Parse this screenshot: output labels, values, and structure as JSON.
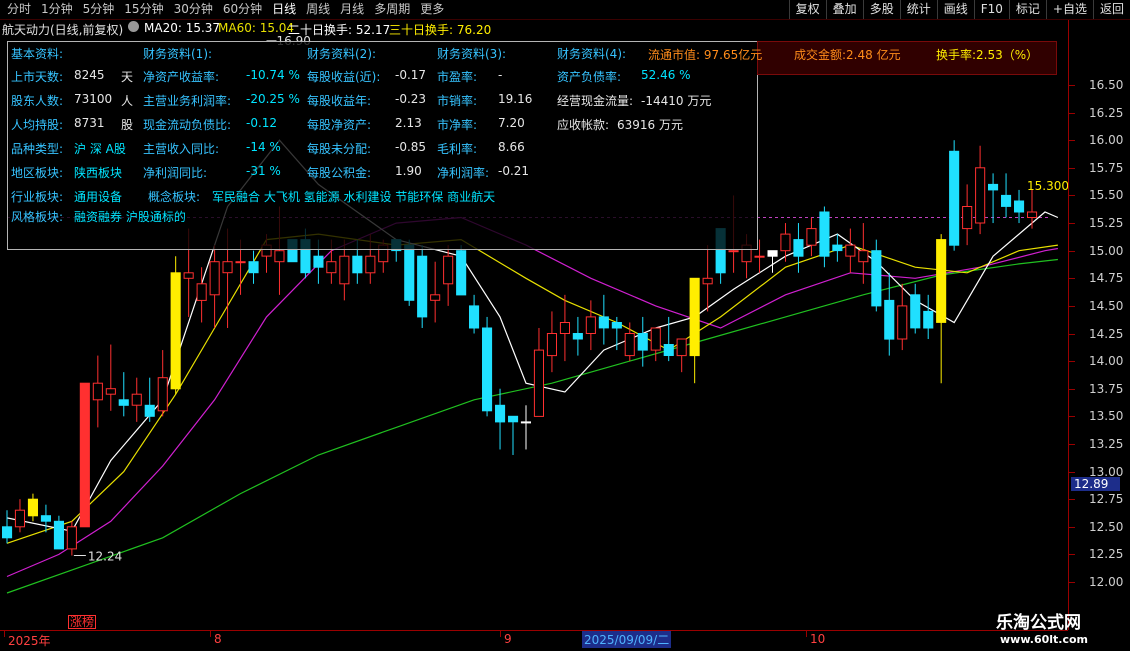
{
  "tabs": [
    "分时",
    "1分钟",
    "5分钟",
    "15分钟",
    "30分钟",
    "60分钟",
    "日线",
    "周线",
    "月线",
    "多周期",
    "更多"
  ],
  "active_tab": "日线",
  "right_buttons": [
    "复权",
    "叠加",
    "多股",
    "统计",
    "画线",
    "F10",
    "标记",
    "+自选",
    "返回"
  ],
  "info": {
    "title": "航天动力(日线,前复权)",
    "ma20": "MA20: 15.37",
    "ma60": "MA60: 15.04",
    "turn20": "二十日换手: 52.17",
    "turn30": "三十日换手: 76.20"
  },
  "panel": {
    "col1_header": "基本资料:",
    "col1": [
      {
        "label": "上市天数:",
        "value": "8245",
        "unit": "天"
      },
      {
        "label": "股东人数:",
        "value": "73100",
        "unit": "人"
      },
      {
        "label": "人均持股:",
        "value": "8731",
        "unit": "股"
      },
      {
        "label": "品种类型:",
        "value": "沪 深 A股",
        "unit": ""
      },
      {
        "label": "地区板块:",
        "value": "陕西板块",
        "unit": ""
      },
      {
        "label": "行业板块:",
        "value": "通用设备",
        "unit": ""
      },
      {
        "label": "风格板块:",
        "value": "融资融券 沪股通标的",
        "unit": ""
      }
    ],
    "col2_header": "财务资料(1):",
    "col2": [
      {
        "label": "净资产收益率:",
        "value": "-10.74 %"
      },
      {
        "label": "主营业务利润率:",
        "value": "-20.25 %"
      },
      {
        "label": "现金流动负债比:",
        "value": "-0.12"
      },
      {
        "label": "主营收入同比:",
        "value": "-14 %"
      },
      {
        "label": "净利润同比:",
        "value": "-31 %"
      }
    ],
    "concept_label": "概念板块:",
    "concept_value": "军民融合 大飞机 氢能源 水利建设 节能环保 商业航天",
    "col3_header": "财务资料(2):",
    "col3": [
      {
        "label": "每股收益(近):",
        "value": "-0.17"
      },
      {
        "label": "每股收益年:",
        "value": "-0.23"
      },
      {
        "label": "每股净资产:",
        "value": "2.13"
      },
      {
        "label": "每股未分配:",
        "value": "-0.85"
      },
      {
        "label": "每股公积金:",
        "value": "1.90"
      }
    ],
    "col4_header": "财务资料(3):",
    "col4": [
      {
        "label": "市盈率:",
        "value": "-"
      },
      {
        "label": "市销率:",
        "value": "19.16"
      },
      {
        "label": "市净率:",
        "value": "7.20"
      },
      {
        "label": "毛利率:",
        "value": "8.66"
      },
      {
        "label": "净利润率:",
        "value": "-0.21"
      }
    ],
    "col5_header": "财务资料(4):",
    "col5": [
      {
        "label": "资产负债率:",
        "value": "52.46 %"
      },
      {
        "label": "经营现金流量:",
        "value": "-14410 万元"
      },
      {
        "label": "应收帐款:",
        "value": "63916 万元"
      }
    ]
  },
  "top_panel": {
    "float_mv": "流通市值: 97.65亿元",
    "turnover_amt": "成交金额:2.48  亿元",
    "turnover_rate": "换手率:2.53（%）"
  },
  "price_axis": [
    "16.50",
    "16.25",
    "16.00",
    "15.75",
    "15.50",
    "15.25",
    "15.00",
    "14.75",
    "14.50",
    "14.25",
    "14.00",
    "13.75",
    "13.50",
    "13.25",
    "13.00",
    "12.75",
    "12.50",
    "12.25",
    "12.00"
  ],
  "current_price": "12.89",
  "annotations": {
    "high": "16.90",
    "low": "12.24",
    "last": "15.300"
  },
  "x_labels": [
    "2025年",
    "8",
    "9",
    "10"
  ],
  "x_cursor_date": "2025/09/09/二",
  "zt_badge": "涨榜",
  "watermark": "乐淘公式网",
  "watermark_url": "www.60lt.com",
  "colors": {
    "up": "#ff3030",
    "down": "#20e0ff",
    "limit": "#ffee00",
    "ma_white": "#ffffff",
    "ma_yellow": "#e8e000",
    "ma_magenta": "#d020d0",
    "ma_green": "#20c020"
  },
  "chart_data": {
    "type": "candlestick",
    "ylim": [
      12.0,
      16.5
    ],
    "candles": [
      {
        "o": 12.5,
        "h": 12.65,
        "l": 12.35,
        "c": 12.4,
        "k": "down"
      },
      {
        "o": 12.5,
        "h": 12.75,
        "l": 12.45,
        "c": 12.65,
        "k": "up"
      },
      {
        "o": 12.6,
        "h": 12.8,
        "l": 12.55,
        "c": 12.75,
        "k": "limit"
      },
      {
        "o": 12.6,
        "h": 12.7,
        "l": 12.45,
        "c": 12.55,
        "k": "down"
      },
      {
        "o": 12.55,
        "h": 12.6,
        "l": 12.3,
        "c": 12.3,
        "k": "down"
      },
      {
        "o": 12.3,
        "h": 12.55,
        "l": 12.24,
        "c": 12.5,
        "k": "up"
      },
      {
        "o": 12.5,
        "h": 13.8,
        "l": 12.5,
        "c": 13.8,
        "k": "limitup"
      },
      {
        "o": 13.65,
        "h": 14.05,
        "l": 13.4,
        "c": 13.8,
        "k": "up"
      },
      {
        "o": 13.75,
        "h": 14.15,
        "l": 13.55,
        "c": 13.7,
        "k": "up"
      },
      {
        "o": 13.65,
        "h": 13.9,
        "l": 13.5,
        "c": 13.6,
        "k": "down"
      },
      {
        "o": 13.6,
        "h": 13.85,
        "l": 13.45,
        "c": 13.7,
        "k": "up"
      },
      {
        "o": 13.6,
        "h": 13.85,
        "l": 13.45,
        "c": 13.5,
        "k": "down"
      },
      {
        "o": 13.55,
        "h": 14.1,
        "l": 13.5,
        "c": 13.85,
        "k": "up"
      },
      {
        "o": 13.75,
        "h": 14.95,
        "l": 13.7,
        "c": 14.8,
        "k": "limit"
      },
      {
        "o": 14.8,
        "h": 15.2,
        "l": 14.4,
        "c": 14.75,
        "k": "up"
      },
      {
        "o": 14.55,
        "h": 14.85,
        "l": 14.35,
        "c": 14.7,
        "k": "up"
      },
      {
        "o": 14.6,
        "h": 15.05,
        "l": 14.3,
        "c": 14.9,
        "k": "up"
      },
      {
        "o": 14.8,
        "h": 15.2,
        "l": 14.3,
        "c": 14.9,
        "k": "up"
      },
      {
        "o": 14.9,
        "h": 15.1,
        "l": 14.6,
        "c": 14.9,
        "k": "up"
      },
      {
        "o": 14.9,
        "h": 15.0,
        "l": 14.7,
        "c": 14.8,
        "k": "down"
      },
      {
        "o": 15.05,
        "h": 15.15,
        "l": 14.8,
        "c": 14.95,
        "k": "up"
      },
      {
        "o": 15.0,
        "h": 15.4,
        "l": 14.6,
        "c": 14.9,
        "k": "up"
      },
      {
        "o": 15.1,
        "h": 15.1,
        "l": 14.9,
        "c": 14.9,
        "k": "down"
      },
      {
        "o": 15.1,
        "h": 15.2,
        "l": 14.75,
        "c": 14.8,
        "k": "down"
      },
      {
        "o": 14.95,
        "h": 15.1,
        "l": 14.7,
        "c": 14.85,
        "k": "down"
      },
      {
        "o": 14.9,
        "h": 15.1,
        "l": 14.7,
        "c": 14.8,
        "k": "up"
      },
      {
        "o": 14.95,
        "h": 15.1,
        "l": 14.55,
        "c": 14.7,
        "k": "up"
      },
      {
        "o": 14.95,
        "h": 15.1,
        "l": 14.7,
        "c": 14.8,
        "k": "down"
      },
      {
        "o": 14.95,
        "h": 15.15,
        "l": 14.7,
        "c": 14.8,
        "k": "up"
      },
      {
        "o": 15.05,
        "h": 15.1,
        "l": 14.8,
        "c": 14.9,
        "k": "up"
      },
      {
        "o": 15.1,
        "h": 15.1,
        "l": 14.9,
        "c": 15.0,
        "k": "down"
      },
      {
        "o": 15.05,
        "h": 15.1,
        "l": 14.5,
        "c": 14.55,
        "k": "down"
      },
      {
        "o": 14.95,
        "h": 15.05,
        "l": 14.3,
        "c": 14.4,
        "k": "down"
      },
      {
        "o": 14.55,
        "h": 14.9,
        "l": 14.35,
        "c": 14.6,
        "k": "up"
      },
      {
        "o": 14.95,
        "h": 15.05,
        "l": 14.5,
        "c": 14.7,
        "k": "up"
      },
      {
        "o": 15.0,
        "h": 15.05,
        "l": 14.65,
        "c": 14.6,
        "k": "down"
      },
      {
        "o": 14.5,
        "h": 14.6,
        "l": 14.25,
        "c": 14.3,
        "k": "down"
      },
      {
        "o": 14.3,
        "h": 14.4,
        "l": 13.5,
        "c": 13.55,
        "k": "down"
      },
      {
        "o": 13.6,
        "h": 13.75,
        "l": 13.2,
        "c": 13.45,
        "k": "down"
      },
      {
        "o": 13.45,
        "h": 13.5,
        "l": 13.15,
        "c": 13.5,
        "k": "down"
      },
      {
        "o": 13.45,
        "h": 13.6,
        "l": 13.2,
        "c": 13.45,
        "k": "doji"
      },
      {
        "o": 13.5,
        "h": 14.3,
        "l": 13.5,
        "c": 14.1,
        "k": "up"
      },
      {
        "o": 14.05,
        "h": 14.45,
        "l": 13.9,
        "c": 14.25,
        "k": "up"
      },
      {
        "o": 14.25,
        "h": 14.6,
        "l": 14.0,
        "c": 14.35,
        "k": "up"
      },
      {
        "o": 14.2,
        "h": 14.4,
        "l": 14.05,
        "c": 14.25,
        "k": "down"
      },
      {
        "o": 14.25,
        "h": 14.55,
        "l": 14.1,
        "c": 14.4,
        "k": "up"
      },
      {
        "o": 14.4,
        "h": 14.6,
        "l": 14.15,
        "c": 14.3,
        "k": "down"
      },
      {
        "o": 14.3,
        "h": 14.4,
        "l": 14.1,
        "c": 14.35,
        "k": "down"
      },
      {
        "o": 14.05,
        "h": 14.35,
        "l": 14.0,
        "c": 14.25,
        "k": "up"
      },
      {
        "o": 14.25,
        "h": 14.4,
        "l": 13.95,
        "c": 14.1,
        "k": "down"
      },
      {
        "o": 14.1,
        "h": 14.3,
        "l": 14.0,
        "c": 14.3,
        "k": "up"
      },
      {
        "o": 14.15,
        "h": 14.4,
        "l": 14.0,
        "c": 14.05,
        "k": "down"
      },
      {
        "o": 14.05,
        "h": 14.2,
        "l": 13.9,
        "c": 14.2,
        "k": "up"
      },
      {
        "o": 14.05,
        "h": 14.75,
        "l": 13.8,
        "c": 14.75,
        "k": "limit"
      },
      {
        "o": 14.75,
        "h": 15.05,
        "l": 14.45,
        "c": 14.7,
        "k": "up"
      },
      {
        "o": 14.8,
        "h": 15.2,
        "l": 14.7,
        "c": 15.2,
        "k": "down"
      },
      {
        "o": 15.0,
        "h": 15.5,
        "l": 14.8,
        "c": 15.0,
        "k": "up"
      },
      {
        "o": 15.05,
        "h": 15.15,
        "l": 14.75,
        "c": 14.9,
        "k": "up"
      },
      {
        "o": 14.95,
        "h": 15.1,
        "l": 14.8,
        "c": 14.95,
        "k": "up"
      },
      {
        "o": 15.0,
        "h": 15.0,
        "l": 14.8,
        "c": 14.95,
        "k": "doji"
      },
      {
        "o": 15.15,
        "h": 15.25,
        "l": 14.9,
        "c": 15.0,
        "k": "up"
      },
      {
        "o": 14.95,
        "h": 15.25,
        "l": 14.8,
        "c": 15.1,
        "k": "down"
      },
      {
        "o": 15.05,
        "h": 15.3,
        "l": 14.95,
        "c": 15.2,
        "k": "up"
      },
      {
        "o": 15.35,
        "h": 15.4,
        "l": 14.85,
        "c": 14.95,
        "k": "down"
      },
      {
        "o": 15.05,
        "h": 15.15,
        "l": 14.9,
        "c": 15.0,
        "k": "down"
      },
      {
        "o": 14.95,
        "h": 15.2,
        "l": 14.8,
        "c": 15.05,
        "k": "up"
      },
      {
        "o": 15.0,
        "h": 15.25,
        "l": 14.7,
        "c": 14.9,
        "k": "up"
      },
      {
        "o": 15.0,
        "h": 15.1,
        "l": 14.45,
        "c": 14.5,
        "k": "down"
      },
      {
        "o": 14.55,
        "h": 14.8,
        "l": 14.05,
        "c": 14.2,
        "k": "down"
      },
      {
        "o": 14.2,
        "h": 14.7,
        "l": 14.1,
        "c": 14.5,
        "k": "up"
      },
      {
        "o": 14.3,
        "h": 14.7,
        "l": 14.25,
        "c": 14.6,
        "k": "down"
      },
      {
        "o": 14.3,
        "h": 14.6,
        "l": 14.2,
        "c": 14.45,
        "k": "down"
      },
      {
        "o": 14.35,
        "h": 15.15,
        "l": 13.8,
        "c": 15.1,
        "k": "limit"
      },
      {
        "o": 15.05,
        "h": 16.0,
        "l": 15.0,
        "c": 15.9,
        "k": "down"
      },
      {
        "o": 15.4,
        "h": 15.6,
        "l": 15.05,
        "c": 15.2,
        "k": "up"
      },
      {
        "o": 15.25,
        "h": 15.95,
        "l": 15.15,
        "c": 15.75,
        "k": "up"
      },
      {
        "o": 15.55,
        "h": 15.7,
        "l": 15.25,
        "c": 15.6,
        "k": "down"
      },
      {
        "o": 15.5,
        "h": 15.7,
        "l": 15.3,
        "c": 15.4,
        "k": "down"
      },
      {
        "o": 15.45,
        "h": 15.55,
        "l": 15.25,
        "c": 15.35,
        "k": "down"
      },
      {
        "o": 15.35,
        "h": 15.55,
        "l": 15.2,
        "c": 15.3,
        "k": "up"
      }
    ],
    "ma_white": [
      [
        0,
        12.58
      ],
      [
        5,
        12.46
      ],
      [
        8,
        13.1
      ],
      [
        12,
        13.65
      ],
      [
        15,
        14.7
      ],
      [
        17,
        15.4
      ],
      [
        21,
        16.0
      ],
      [
        24,
        15.6
      ],
      [
        30,
        15.1
      ],
      [
        35,
        14.95
      ],
      [
        38,
        14.4
      ],
      [
        40,
        13.8
      ],
      [
        43,
        13.72
      ],
      [
        46,
        14.1
      ],
      [
        50,
        14.3
      ],
      [
        53,
        14.4
      ],
      [
        56,
        14.65
      ],
      [
        60,
        14.95
      ],
      [
        64,
        15.15
      ],
      [
        67,
        14.9
      ],
      [
        70,
        14.55
      ],
      [
        73,
        14.35
      ],
      [
        76,
        14.95
      ],
      [
        80,
        15.35
      ],
      [
        81,
        15.3
      ]
    ],
    "ma_yellow": [
      [
        0,
        12.35
      ],
      [
        5,
        12.55
      ],
      [
        9,
        13.0
      ],
      [
        13,
        13.7
      ],
      [
        16,
        14.3
      ],
      [
        20,
        15.1
      ],
      [
        24,
        15.15
      ],
      [
        30,
        15.05
      ],
      [
        35,
        15.1
      ],
      [
        40,
        14.75
      ],
      [
        43,
        14.55
      ],
      [
        47,
        14.35
      ],
      [
        51,
        14.1
      ],
      [
        55,
        14.4
      ],
      [
        60,
        14.85
      ],
      [
        65,
        15.05
      ],
      [
        70,
        14.85
      ],
      [
        74,
        14.8
      ],
      [
        78,
        15.0
      ],
      [
        81,
        15.05
      ]
    ],
    "ma_magenta": [
      [
        0,
        12.05
      ],
      [
        4,
        12.25
      ],
      [
        8,
        12.55
      ],
      [
        12,
        13.05
      ],
      [
        16,
        13.65
      ],
      [
        20,
        14.4
      ],
      [
        25,
        15.0
      ],
      [
        30,
        15.25
      ],
      [
        35,
        15.3
      ],
      [
        40,
        15.05
      ],
      [
        45,
        14.75
      ],
      [
        50,
        14.5
      ],
      [
        55,
        14.3
      ],
      [
        60,
        14.6
      ],
      [
        65,
        14.8
      ],
      [
        70,
        14.75
      ],
      [
        75,
        14.85
      ],
      [
        80,
        15.0
      ],
      [
        81,
        15.02
      ]
    ],
    "ma_green": [
      [
        0,
        11.9
      ],
      [
        6,
        12.15
      ],
      [
        12,
        12.4
      ],
      [
        18,
        12.8
      ],
      [
        24,
        13.15
      ],
      [
        30,
        13.4
      ],
      [
        36,
        13.65
      ],
      [
        42,
        13.8
      ],
      [
        48,
        14.0
      ],
      [
        54,
        14.2
      ],
      [
        60,
        14.4
      ],
      [
        66,
        14.6
      ],
      [
        72,
        14.78
      ],
      [
        78,
        14.88
      ],
      [
        81,
        14.92
      ]
    ],
    "dashed_level": 15.3
  }
}
